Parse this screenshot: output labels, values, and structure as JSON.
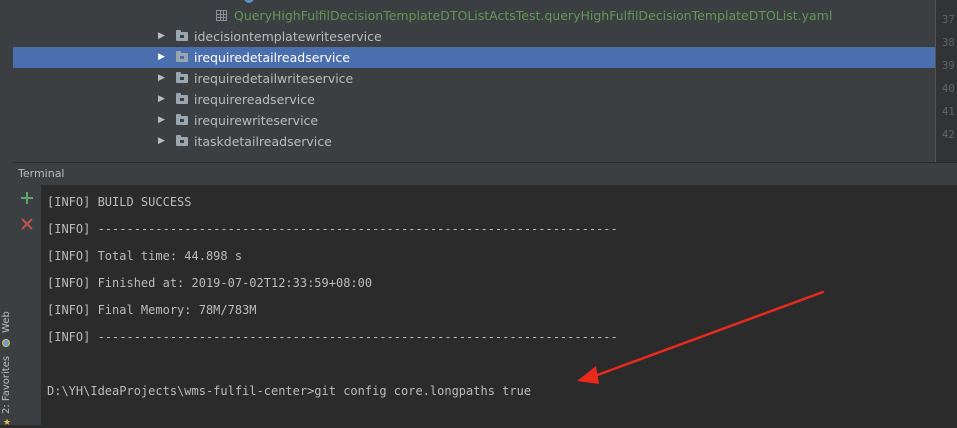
{
  "sidebar": {
    "web_label": "Web",
    "favorites_label": "2: Favorites"
  },
  "project_tree": {
    "file_item": "QueryHighFulfilDecisionTemplateDTOListActsTest.queryHighFulfilDecisionTemplateDTOList.yaml",
    "folders": [
      {
        "label": "idecisiontemplatewriteservice",
        "selected": false
      },
      {
        "label": "irequiredetailreadservice",
        "selected": true
      },
      {
        "label": "irequiredetailwriteservice",
        "selected": false
      },
      {
        "label": "irequirereadservice",
        "selected": false
      },
      {
        "label": "irequirewriteservice",
        "selected": false
      },
      {
        "label": "itaskdetailreadservice",
        "selected": false
      }
    ]
  },
  "editor_gutter": {
    "line_numbers": [
      "37",
      "38",
      "39",
      "40",
      "41",
      "42"
    ]
  },
  "terminal": {
    "title": "Terminal",
    "lines": [
      "[INFO] BUILD SUCCESS",
      "[INFO] ------------------------------------------------------------------------",
      "[INFO] Total time: 44.898 s",
      "[INFO] Finished at: 2019-07-02T12:33:59+08:00",
      "[INFO] Final Memory: 78M/783M",
      "[INFO] ------------------------------------------------------------------------",
      "",
      "D:\\YH\\IdeaProjects\\wms-fulfil-center>git config core.longpaths true"
    ]
  },
  "colors": {
    "selection": "#4b6eaf",
    "annotation_arrow": "#e8291c",
    "add_icon": "#59a869",
    "close_icon": "#c75450"
  },
  "icons": [
    "folder-icon",
    "yaml-file-icon",
    "add-terminal-icon",
    "close-terminal-icon",
    "web-icon",
    "favorites-star-icon",
    "annotation-arrow"
  ]
}
